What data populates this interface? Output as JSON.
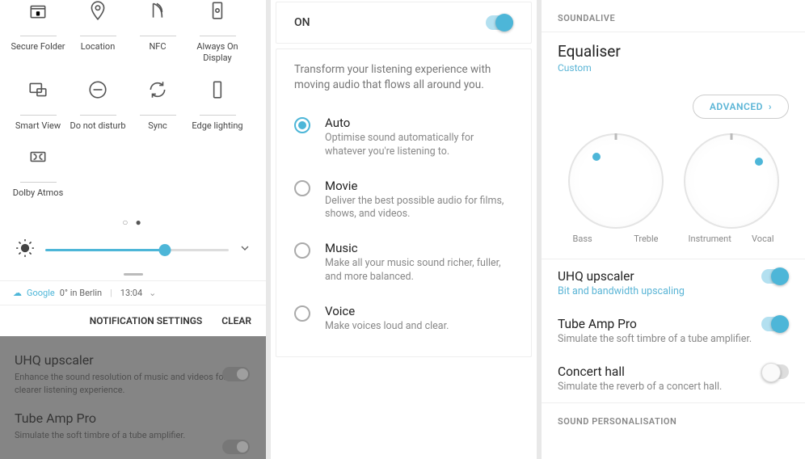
{
  "panel1": {
    "qs": [
      {
        "label": "Secure Folder",
        "icon": "folder-lock"
      },
      {
        "label": "Location",
        "icon": "location"
      },
      {
        "label": "NFC",
        "icon": "nfc"
      },
      {
        "label": "Always On Display",
        "icon": "aod"
      },
      {
        "label": "Smart View",
        "icon": "smart-view"
      },
      {
        "label": "Do not disturb",
        "icon": "dnd"
      },
      {
        "label": "Sync",
        "icon": "sync"
      },
      {
        "label": "Edge lighting",
        "icon": "edge"
      },
      {
        "label": "Dolby Atmos",
        "icon": "dolby"
      }
    ],
    "weather": {
      "google": "Google",
      "text": "0° in Berlin",
      "time": "13:04"
    },
    "notif": {
      "settings": "NOTIFICATION SETTINGS",
      "clear": "CLEAR"
    },
    "dim": {
      "uhq_title": "UHQ upscaler",
      "uhq_sub": "Enhance the sound resolution of music and videos for a clearer listening experience.",
      "tube_title": "Tube Amp Pro",
      "tube_sub": "Simulate the soft timbre of a tube amplifier."
    }
  },
  "panel2": {
    "on_label": "ON",
    "intro": "Transform your listening experience with moving audio that flows all around you.",
    "options": [
      {
        "title": "Auto",
        "desc": "Optimise sound automatically for whatever you're listening to.",
        "selected": true
      },
      {
        "title": "Movie",
        "desc": "Deliver the best possible audio for films, shows, and videos.",
        "selected": false
      },
      {
        "title": "Music",
        "desc": "Make all your music sound richer, fuller, and more balanced.",
        "selected": false
      },
      {
        "title": "Voice",
        "desc": "Make voices loud and clear.",
        "selected": false
      }
    ]
  },
  "panel3": {
    "section1": "SOUNDALIVE",
    "eq_title": "Equaliser",
    "eq_sub": "Custom",
    "advanced": "ADVANCED",
    "dial_labels": {
      "bass": "Bass",
      "treble": "Treble",
      "instrument": "Instrument",
      "vocal": "Vocal"
    },
    "settings": [
      {
        "title": "UHQ upscaler",
        "sub": "Bit and bandwidth upscaling",
        "link": true,
        "on": true
      },
      {
        "title": "Tube Amp Pro",
        "sub": "Simulate the soft timbre of a tube amplifier.",
        "link": false,
        "on": true
      },
      {
        "title": "Concert hall",
        "sub": "Simulate the reverb of a concert hall.",
        "link": false,
        "on": false
      }
    ],
    "section2": "SOUND PERSONALISATION"
  }
}
